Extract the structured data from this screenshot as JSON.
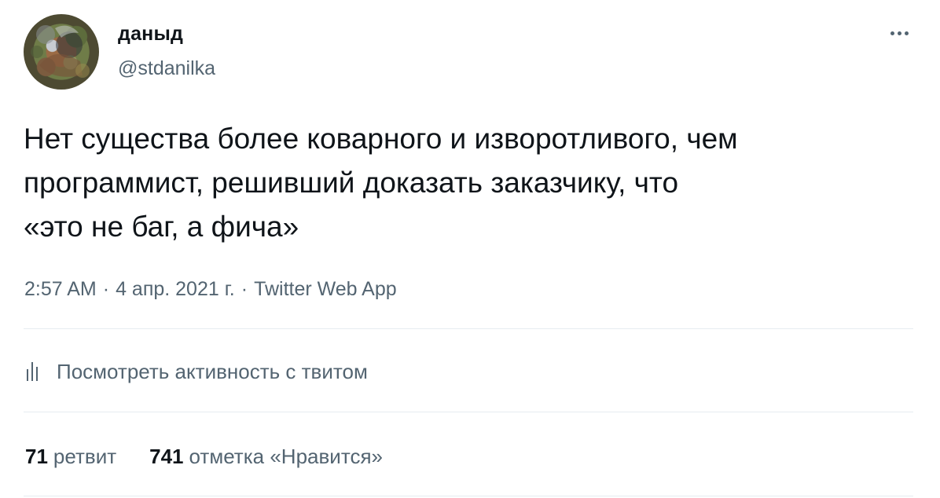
{
  "tweet": {
    "author": {
      "display_name": "даныд",
      "handle": "@stdanilka",
      "avatar_icon": "profile-photo-icon"
    },
    "more_icon": "more-options-icon",
    "text": "Нет существа более коварного и изворотливого, чем\nпрограммист, решивший доказать заказчику, что\n«это не баг, а фича»",
    "meta": {
      "time": "2:57 AM",
      "separator": "·",
      "date": "4 апр. 2021 г.",
      "source": "Twitter Web App"
    },
    "activity": {
      "icon": "analytics-bars-icon",
      "label": "Посмотреть активность с твитом"
    },
    "stats": {
      "retweets_count": "71",
      "retweets_label": "ретвит",
      "likes_count": "741",
      "likes_label": "отметка «Нравится»"
    }
  },
  "colors": {
    "text_primary": "#0f1419",
    "text_secondary": "#536471",
    "divider": "#e6ecf0",
    "background": "#ffffff"
  }
}
